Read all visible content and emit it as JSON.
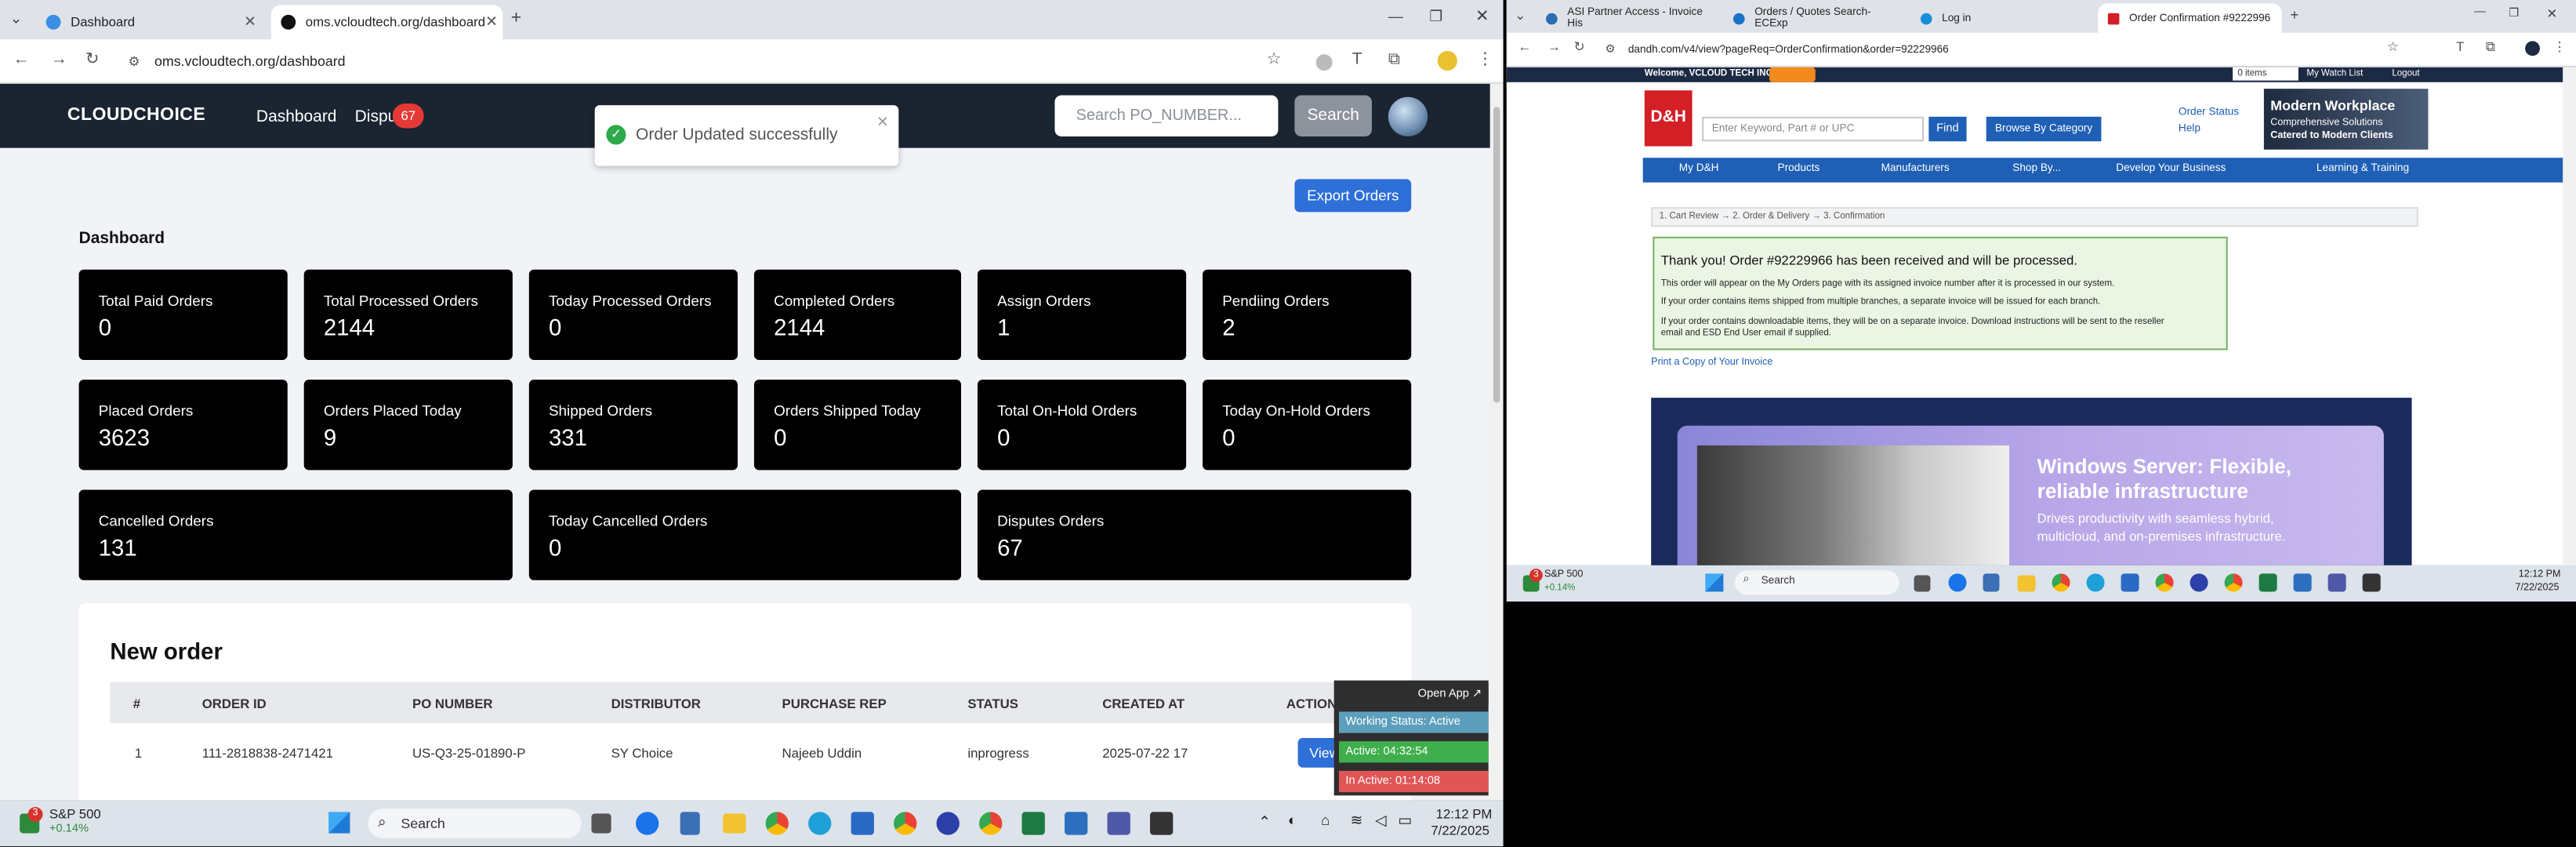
{
  "left_browser": {
    "tabs": [
      {
        "title": "Dashboard"
      },
      {
        "title": "oms.vcloudtech.org/dashboard"
      }
    ],
    "url": "oms.vcloudtech.org/dashboard"
  },
  "app": {
    "logo": "CLOUDCHOICE",
    "nav": {
      "dashboard": "Dashboard",
      "disputes": "Dispu",
      "disputes_badge": "67"
    },
    "search_placeholder": "Search PO_NUMBER...",
    "search_button": "Search",
    "toast": "Order Updated successfully",
    "export_button": "Export Orders",
    "dashboard_title": "Dashboard",
    "cards": [
      {
        "label": "Total Paid Orders",
        "value": "0"
      },
      {
        "label": "Total Processed Orders",
        "value": "2144"
      },
      {
        "label": "Today Processed Orders",
        "value": "0"
      },
      {
        "label": "Completed Orders",
        "value": "2144"
      },
      {
        "label": "Assign Orders",
        "value": "1"
      },
      {
        "label": "Pendiing Orders",
        "value": "2"
      },
      {
        "label": "Placed Orders",
        "value": "3623"
      },
      {
        "label": "Orders Placed Today",
        "value": "9"
      },
      {
        "label": "Shipped Orders",
        "value": "331"
      },
      {
        "label": "Orders Shipped Today",
        "value": "0"
      },
      {
        "label": "Total On-Hold Orders",
        "value": "0"
      },
      {
        "label": "Today On-Hold Orders",
        "value": "0"
      },
      {
        "label": "Cancelled Orders",
        "value": "131"
      },
      {
        "label": "Today Cancelled Orders",
        "value": "0"
      },
      {
        "label": "Disputes Orders",
        "value": "67"
      }
    ],
    "new_order": {
      "title": "New order",
      "columns": [
        "#",
        "ORDER ID",
        "PO NUMBER",
        "DISTRIBUTOR",
        "PURCHASE REP",
        "STATUS",
        "CREATED AT",
        "ACTION"
      ],
      "rows": [
        {
          "num": "1",
          "order_id": "111-2818838-2471421",
          "po": "US-Q3-25-01890-P",
          "distributor": "SY Choice",
          "rep": "Najeeb Uddin",
          "status": "inprogress",
          "created": "2025-07-22 17",
          "action": "View"
        }
      ]
    },
    "work_status": {
      "open_app": "Open App ↗",
      "status": "Working Status: Active",
      "active": "Active: 04:32:54",
      "inactive": "In Active: 01:14:08"
    }
  },
  "left_taskbar": {
    "stock_badge": "3",
    "stock_name": "S&P 500",
    "stock_change": "+0.14%",
    "search": "Search",
    "time": "12:12 PM",
    "date": "7/22/2025"
  },
  "right_browser": {
    "tabs": [
      {
        "title": "ASI Partner Access - Invoice His"
      },
      {
        "title": "Orders / Quotes Search- ECExp"
      },
      {
        "title": "Log in"
      },
      {
        "title": "Order Confirmation #9222996"
      }
    ],
    "url": "dandh.com/v4/view?pageReq=OrderConfirmation&order=92229966",
    "welcome": "Welcome, VCLOUD TECH INC",
    "cart": "0 items",
    "watch_list": "My Watch List",
    "logout": "Logout",
    "logo": "D&H",
    "search_placeholder": "Enter Keyword, Part # or UPC",
    "find": "Find",
    "browse": "Browse By Category",
    "order_status": "Order Status",
    "help": "Help",
    "modern": {
      "title": "Modern Workplace",
      "line1": "Comprehensive Solutions",
      "line2": "Catered to Modern Clients"
    },
    "menu": [
      "My D&H",
      "Products",
      "Manufacturers",
      "Shop By...",
      "Develop Your Business",
      "Learning & Training"
    ],
    "crumbs": "1. Cart Review  →  2. Order & Delivery  →  3. Confirmation",
    "thanks": "Thank you! Order #92229966 has been received and will be processed.",
    "lines": [
      "This order will appear on the My Orders page with its assigned invoice number after it is processed in our system.",
      "If your order contains items shipped from multiple branches, a separate invoice will be issued for each branch.",
      "If your order contains downloadable items, they will be on a separate invoice. Download instructions will be sent to the reseller",
      "email and ESD End User email if supplied."
    ],
    "print": "Print a Copy of Your Invoice",
    "banner_title_1": "Windows Server: Flexible,",
    "banner_title_2": "reliable infrastructure",
    "banner_sub_1": "Drives productivity with seamless hybrid,",
    "banner_sub_2": "multicloud, and on-premises infrastructure."
  },
  "right_taskbar": {
    "stock_badge": "3",
    "stock_name": "S&P 500",
    "stock_change": "+0.14%",
    "search": "Search",
    "time": "12:12 PM",
    "date": "7/22/2025"
  },
  "colors": {
    "appbar": "#1b2431",
    "accent": "#2e6fd8",
    "dh_red": "#d31f26",
    "dh_blue": "#1f5fb5"
  }
}
